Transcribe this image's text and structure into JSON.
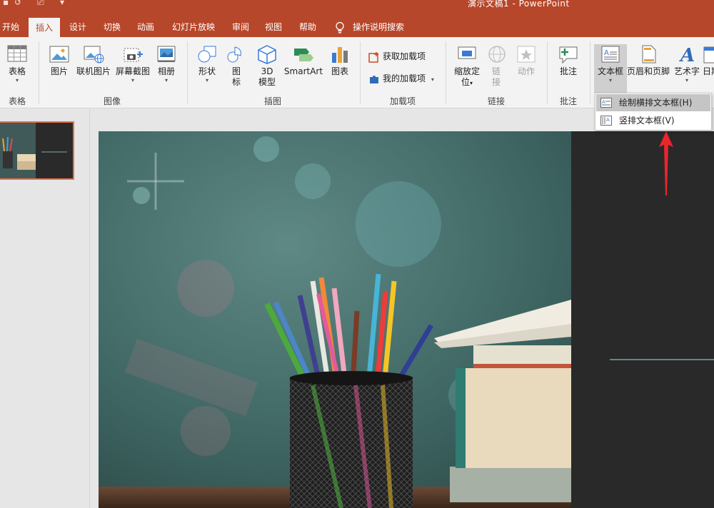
{
  "window": {
    "doc_title": "演示文稿1 - PowerPoint"
  },
  "tabs": [
    {
      "label": "开始"
    },
    {
      "label": "插入"
    },
    {
      "label": "设计"
    },
    {
      "label": "切换"
    },
    {
      "label": "动画"
    },
    {
      "label": "幻灯片放映"
    },
    {
      "label": "审阅"
    },
    {
      "label": "视图"
    },
    {
      "label": "帮助"
    }
  ],
  "active_tab": "插入",
  "tell_me": "操作说明搜索",
  "ribbon": {
    "table": {
      "label": "表格",
      "group": "表格"
    },
    "images": {
      "group": "图像",
      "picture": "图片",
      "online_picture": "联机图片",
      "screenshot": "屏幕截图",
      "album": "相册"
    },
    "illustrations": {
      "group": "插图",
      "shapes": "形状",
      "icons_1": "图",
      "icons_2": "标",
      "model_1": "3D",
      "model_2": "模型",
      "smartart": "SmartArt",
      "chart": "图表"
    },
    "addins": {
      "group": "加载项",
      "get": "获取加载项",
      "mine": "我的加载项"
    },
    "links": {
      "group": "链接",
      "zoom_1": "缩放定",
      "zoom_2": "位",
      "link_1": "链",
      "link_2": "接",
      "action": "动作"
    },
    "comments": {
      "group": "批注",
      "comment": "批注"
    },
    "text": {
      "textbox": "文本框",
      "header_footer": "页眉和页脚",
      "wordart": "艺术字",
      "date": "日期"
    }
  },
  "textbox_menu": {
    "horizontal": "绘制横排文本框(H)",
    "vertical": "竖排文本框(V)"
  },
  "colors": {
    "accent": "#b7472a",
    "arrow": "#e8262b",
    "ribbon": "#f3f3f3"
  }
}
